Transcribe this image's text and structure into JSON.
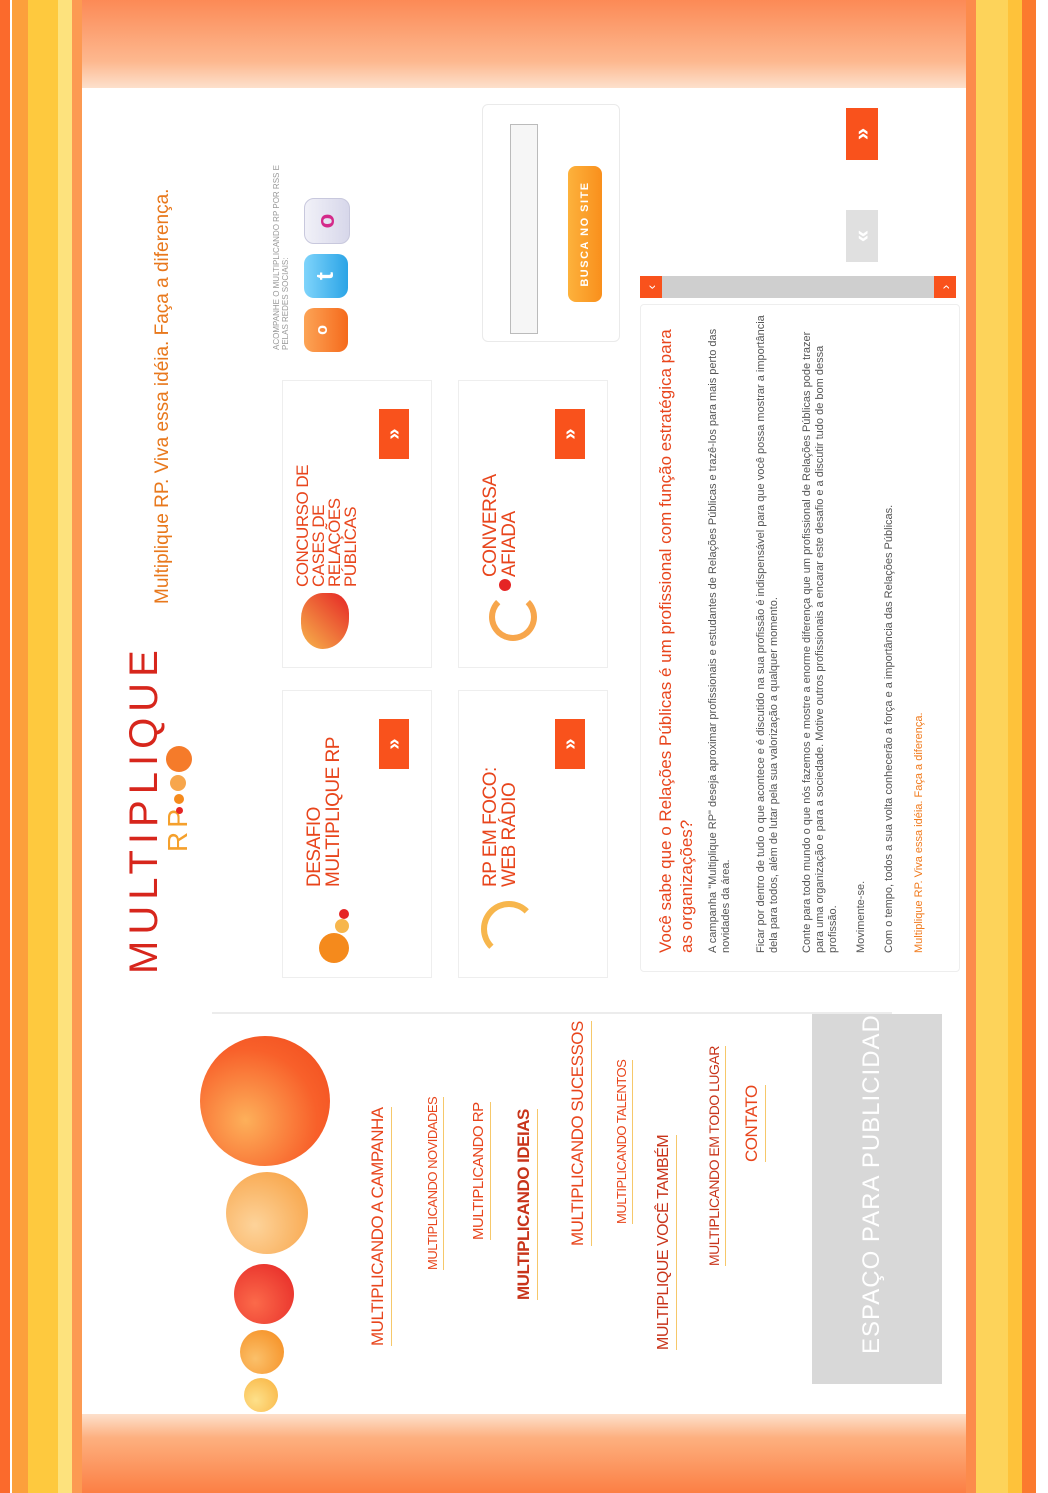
{
  "tagline": "Multiplique RP. Viva essa idéia. Faça a diferença.",
  "logo": {
    "word": "MULTIPLIQUE",
    "sub": "RP"
  },
  "nav": [
    {
      "label": "MULTIPLICANDO A CAMPANHA"
    },
    {
      "label": "MULTIPLICANDO NOVIDADES"
    },
    {
      "label": "MULTIPLICANDO RP"
    },
    {
      "label": "MULTIPLICANDO IDEIAS"
    },
    {
      "label": "MULTIPLICANDO SUCESSOS"
    },
    {
      "label": "MULTIPLICANDO TALENTOS"
    },
    {
      "label": "MULTIPLIQUE VOCÊ TAMBÉM"
    },
    {
      "label": "MULTIPLICANDO EM TODO LUGAR"
    },
    {
      "label": "CONTATO"
    }
  ],
  "ad": {
    "label": "ESPAÇO PARA PUBLICIDADE"
  },
  "features": [
    {
      "title": "DESAFIO MULTIPLIQUE RP",
      "arrow": "»"
    },
    {
      "title": "CONCURSO DE CASES DE RELAÇÕES PÚBLICAS",
      "arrow": "»"
    },
    {
      "title": "RP EM FOCO: WEB RÁDIO",
      "arrow": "»"
    },
    {
      "title": "CONVERSA AFIADA",
      "arrow": "»"
    }
  ],
  "social": {
    "text": "ACOMPANHE O MULTIPLICANDO RP POR RSS E PELAS REDES SOCIAIS:",
    "icons": [
      "rss-icon",
      "twitter-icon",
      "flickr-icon"
    ]
  },
  "search": {
    "button": "BUSCA NO SITE",
    "value": ""
  },
  "article": {
    "title": "Você sabe que o Relações Públicas é um profissional com função estratégica para as organizações?",
    "paragraphs": [
      "A campanha \"Multiplique RP\" deseja aproximar profissionais e estudantes de Relações Públicas e trazê-los para mais perto das novidades da área.",
      "Ficar por dentro de tudo o que acontece e é discutido na sua profissão é indispensável para que você possa mostrar a importância dela para todos, além de lutar pela sua valorização a qualquer momento.",
      "Conte para todo mundo o que nós fazemos e mostre a enorme diferença que um profissional de Relações Públicas pode trazer para uma organização e para a sociedade. Motive outros profissionais a encarar este desafio e a discutir tudo de bom dessa profissão.",
      "Movimente-se.",
      "Com o tempo, todos a sua volta conhecerão a força e a importância das Relações Públicas.",
      "Multiplique RP. Viva essa idéia. Faça a diferença."
    ]
  },
  "scroll": {
    "up": "‹",
    "down": "›"
  },
  "pager": {
    "prev": "«",
    "next": "»"
  },
  "colors": {
    "accent": "#f9521c",
    "text_orange": "#e8451c",
    "brand_red": "#d7261c"
  }
}
